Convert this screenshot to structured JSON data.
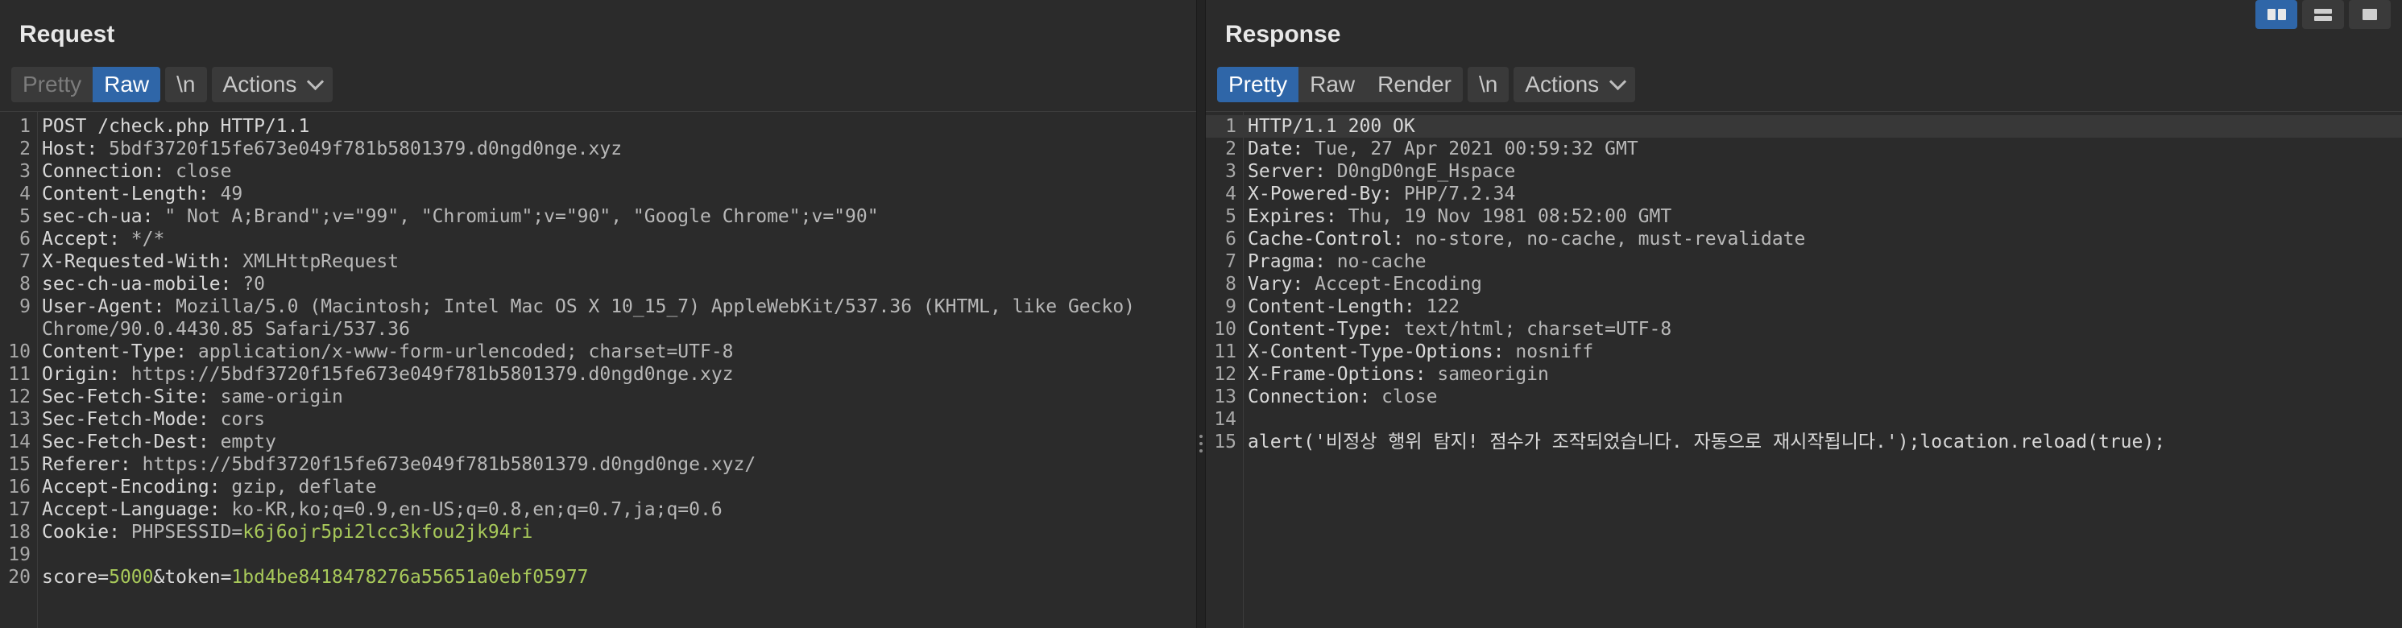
{
  "request": {
    "title": "Request",
    "tabs": {
      "pretty": "Pretty",
      "raw": "Raw",
      "newline": "\\n",
      "actions": "Actions"
    },
    "lines": [
      {
        "n": "1",
        "k": "POST /check.php HTTP/1.1",
        "v": ""
      },
      {
        "n": "2",
        "k": "Host:",
        "v": " 5bdf3720f15fe673e049f781b5801379.d0ngd0nge.xyz"
      },
      {
        "n": "3",
        "k": "Connection:",
        "v": " close"
      },
      {
        "n": "4",
        "k": "Content-Length:",
        "v": " 49"
      },
      {
        "n": "5",
        "k": "sec-ch-ua:",
        "v": " \" Not A;Brand\";v=\"99\", \"Chromium\";v=\"90\", \"Google Chrome\";v=\"90\""
      },
      {
        "n": "6",
        "k": "Accept:",
        "v": " */*"
      },
      {
        "n": "7",
        "k": "X-Requested-With:",
        "v": " XMLHttpRequest"
      },
      {
        "n": "8",
        "k": "sec-ch-ua-mobile:",
        "v": " ?0"
      },
      {
        "n": "9",
        "k": "User-Agent:",
        "v": " Mozilla/5.0 (Macintosh; Intel Mac OS X 10_15_7) AppleWebKit/537.36 (KHTML, like Gecko) Chrome/90.0.4430.85 Safari/537.36"
      },
      {
        "n": "10",
        "k": "Content-Type:",
        "v": " application/x-www-form-urlencoded; charset=UTF-8"
      },
      {
        "n": "11",
        "k": "Origin:",
        "v": " https://5bdf3720f15fe673e049f781b5801379.d0ngd0nge.xyz"
      },
      {
        "n": "12",
        "k": "Sec-Fetch-Site:",
        "v": " same-origin"
      },
      {
        "n": "13",
        "k": "Sec-Fetch-Mode:",
        "v": " cors"
      },
      {
        "n": "14",
        "k": "Sec-Fetch-Dest:",
        "v": " empty"
      },
      {
        "n": "15",
        "k": "Referer:",
        "v": " https://5bdf3720f15fe673e049f781b5801379.d0ngd0nge.xyz/"
      },
      {
        "n": "16",
        "k": "Accept-Encoding:",
        "v": " gzip, deflate"
      },
      {
        "n": "17",
        "k": "Accept-Language:",
        "v": " ko-KR,ko;q=0.9,en-US;q=0.8,en;q=0.7,ja;q=0.6"
      },
      {
        "n": "18",
        "k": "Cookie:",
        "v": " PHPSESSID=",
        "p": "k6j6ojr5pi2lcc3kfou2jk94ri"
      },
      {
        "n": "19",
        "k": "",
        "v": ""
      },
      {
        "n": "20",
        "k": "score=",
        "p": "5000",
        "k2": "&token=",
        "p2": "1bd4be8418478276a55651a0ebf05977"
      }
    ]
  },
  "response": {
    "title": "Response",
    "tabs": {
      "pretty": "Pretty",
      "raw": "Raw",
      "render": "Render",
      "newline": "\\n",
      "actions": "Actions"
    },
    "lines": [
      {
        "n": "1",
        "k": "HTTP/1.1 200 OK",
        "v": ""
      },
      {
        "n": "2",
        "k": "Date:",
        "v": " Tue, 27 Apr 2021 00:59:32 GMT"
      },
      {
        "n": "3",
        "k": "Server:",
        "v": " D0ngD0ngE_Hspace"
      },
      {
        "n": "4",
        "k": "X-Powered-By:",
        "v": " PHP/7.2.34"
      },
      {
        "n": "5",
        "k": "Expires:",
        "v": " Thu, 19 Nov 1981 08:52:00 GMT"
      },
      {
        "n": "6",
        "k": "Cache-Control:",
        "v": " no-store, no-cache, must-revalidate"
      },
      {
        "n": "7",
        "k": "Pragma:",
        "v": " no-cache"
      },
      {
        "n": "8",
        "k": "Vary:",
        "v": " Accept-Encoding"
      },
      {
        "n": "9",
        "k": "Content-Length:",
        "v": " 122"
      },
      {
        "n": "10",
        "k": "Content-Type:",
        "v": " text/html; charset=UTF-8"
      },
      {
        "n": "11",
        "k": "X-Content-Type-Options:",
        "v": " nosniff"
      },
      {
        "n": "12",
        "k": "X-Frame-Options:",
        "v": " sameorigin"
      },
      {
        "n": "13",
        "k": "Connection:",
        "v": " close"
      },
      {
        "n": "14",
        "k": "",
        "v": ""
      },
      {
        "n": "15",
        "k": "alert('비정상 행위 탐지! 점수가 조작되었습니다. 자동으로 재시작됩니다.');location.reload(true);",
        "v": ""
      }
    ]
  }
}
